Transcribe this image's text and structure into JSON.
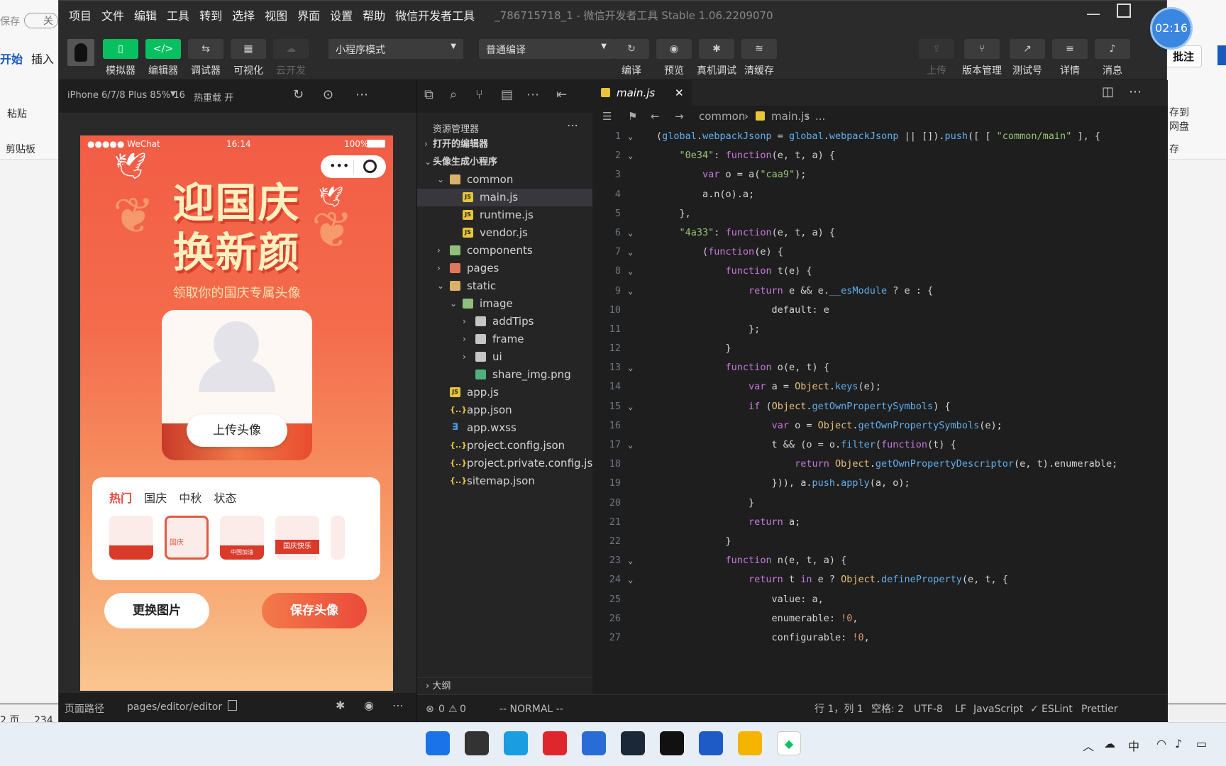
{
  "background_app": {
    "autosave_label": "保存",
    "toggle_label": "关",
    "tabs": [
      "开始",
      "插入"
    ],
    "paste_label": "粘贴",
    "clipboard_label": "剪贴板",
    "comment_button": "批注",
    "save_to_cloud": [
      "存到",
      "网盘"
    ],
    "save_fragment": "存",
    "page_label": "2 页",
    "word_count_fragment": "234"
  },
  "window": {
    "menu": [
      "项目",
      "文件",
      "编辑",
      "工具",
      "转到",
      "选择",
      "视图",
      "界面",
      "设置",
      "帮助",
      "微信开发者工具"
    ],
    "title": "_786715718_1 - 微信开发者工具 Stable 1.06.2209070"
  },
  "toolbar": {
    "left_buttons": [
      {
        "icon": "phone-icon",
        "label": "模拟器"
      },
      {
        "icon": "code-icon",
        "label": "编辑器"
      },
      {
        "icon": "debug-icon",
        "label": "调试器"
      },
      {
        "icon": "layout-icon",
        "label": "可视化"
      },
      {
        "icon": "cloud-icon",
        "label": "云开发"
      }
    ],
    "mode_select": "小程序模式",
    "compile_select": "普通编译",
    "mid_buttons": [
      {
        "icon": "refresh-icon",
        "label": "编译"
      },
      {
        "icon": "eye-icon",
        "label": "预览"
      },
      {
        "icon": "bug-icon",
        "label": "真机调试"
      },
      {
        "icon": "layers-icon",
        "label": "清缓存"
      }
    ],
    "right_buttons": [
      {
        "icon": "upload-icon",
        "label": "上传"
      },
      {
        "icon": "branch-icon",
        "label": "版本管理"
      },
      {
        "icon": "share-icon",
        "label": "测试号"
      },
      {
        "icon": "menu-icon",
        "label": "详情"
      },
      {
        "icon": "bell-icon",
        "label": "消息"
      }
    ]
  },
  "simulator": {
    "device": "iPhone 6/7/8 Plus 85% 16",
    "hot_reload": "热重载 开",
    "status": {
      "carrier": "●●●●● WeChat",
      "time": "16:14",
      "battery": "100%"
    },
    "title_line1": "迎国庆",
    "title_line2": "换新颜",
    "subtitle": "领取你的国庆专属头像",
    "upload_button": "上传头像",
    "categories": [
      "热门",
      "国庆",
      "中秋",
      "状态"
    ],
    "thumb_texts": [
      "",
      "国庆",
      "中国加油",
      "国庆快乐",
      ""
    ],
    "swap_button": "更换图片",
    "save_button": "保存头像",
    "footer_path_label": "页面路径",
    "footer_path": "pages/editor/editor"
  },
  "explorer": {
    "header": "资源管理器",
    "sections": {
      "open_editors": "打开的编辑器",
      "project": "头像生成小程序",
      "outline": "大纲"
    },
    "items": [
      {
        "name": "common",
        "type": "folder",
        "depth": 1,
        "open": true
      },
      {
        "name": "main.js",
        "type": "js",
        "depth": 2,
        "selected": true
      },
      {
        "name": "runtime.js",
        "type": "js",
        "depth": 2
      },
      {
        "name": "vendor.js",
        "type": "js",
        "depth": 2
      },
      {
        "name": "components",
        "type": "folder-g",
        "depth": 1,
        "open": false
      },
      {
        "name": "pages",
        "type": "folder-r",
        "depth": 1,
        "open": false
      },
      {
        "name": "static",
        "type": "folder",
        "depth": 1,
        "open": true
      },
      {
        "name": "image",
        "type": "folder-g",
        "depth": 2,
        "open": true
      },
      {
        "name": "addTips",
        "type": "folder-w",
        "depth": 3,
        "open": false
      },
      {
        "name": "frame",
        "type": "folder-w",
        "depth": 3,
        "open": false
      },
      {
        "name": "ui",
        "type": "folder-w",
        "depth": 3,
        "open": false
      },
      {
        "name": "share_img.png",
        "type": "png",
        "depth": 3
      },
      {
        "name": "app.js",
        "type": "js",
        "depth": 1
      },
      {
        "name": "app.json",
        "type": "json",
        "depth": 1
      },
      {
        "name": "app.wxss",
        "type": "wxss",
        "depth": 1
      },
      {
        "name": "project.config.json",
        "type": "json",
        "depth": 1
      },
      {
        "name": "project.private.config.js...",
        "type": "json",
        "depth": 1
      },
      {
        "name": "sitemap.json",
        "type": "json",
        "depth": 1
      }
    ]
  },
  "editor": {
    "tab": "main.js",
    "breadcrumb": [
      "common",
      "main.js",
      "..."
    ],
    "lines": [
      "(global.webpackJsonp = global.webpackJsonp || []).push([ [ \"common/main\" ], {",
      "    \"0e34\": function(e, t, a) {",
      "        var o = a(\"caa9\");",
      "        a.n(o).a;",
      "    },",
      "    \"4a33\": function(e, t, a) {",
      "        (function(e) {",
      "            function t(e) {",
      "                return e && e.__esModule ? e : {",
      "                    default: e",
      "                };",
      "            }",
      "            function o(e, t) {",
      "                var a = Object.keys(e);",
      "                if (Object.getOwnPropertySymbols) {",
      "                    var o = Object.getOwnPropertySymbols(e);",
      "                    t && (o = o.filter(function(t) {",
      "                        return Object.getOwnPropertyDescriptor(e, t).enumerable;",
      "                    })), a.push.apply(a, o);",
      "                }",
      "                return a;",
      "            }",
      "            function n(e, t, a) {",
      "                return t in e ? Object.defineProperty(e, t, {",
      "                    value: a,",
      "                    enumerable: !0,",
      "                    configurable: !0,"
    ],
    "folds": [
      1,
      2,
      6,
      7,
      8,
      9,
      13,
      15,
      17,
      23,
      24
    ]
  },
  "statusbar": {
    "errors": "0",
    "warnings": "0",
    "mode": "-- NORMAL --",
    "position": "行 1，列 1",
    "spaces": "空格: 2",
    "encoding": "UTF-8",
    "eol": "LF",
    "language": "JavaScript",
    "eslint": "ESLint",
    "prettier": "Prettier"
  },
  "clock": "02:16",
  "taskbar": {
    "apps": [
      {
        "icon": "windows-start-icon",
        "color": "#1a73e8"
      },
      {
        "icon": "task-view-icon",
        "color": "#333333"
      },
      {
        "icon": "edge-icon",
        "color": "#1b9de2"
      },
      {
        "icon": "netease-music-icon",
        "color": "#e0262d"
      },
      {
        "icon": "store-icon",
        "color": "#2a6cd6"
      },
      {
        "icon": "steam-icon",
        "color": "#1b2838"
      },
      {
        "icon": "tiktok-icon",
        "color": "#111111"
      },
      {
        "icon": "word-icon",
        "color": "#1e5bc6"
      },
      {
        "icon": "file-explorer-icon",
        "color": "#f4b400"
      },
      {
        "icon": "wechat-devtools-icon",
        "color": "#ffffff"
      }
    ],
    "tray_ime": "中"
  }
}
